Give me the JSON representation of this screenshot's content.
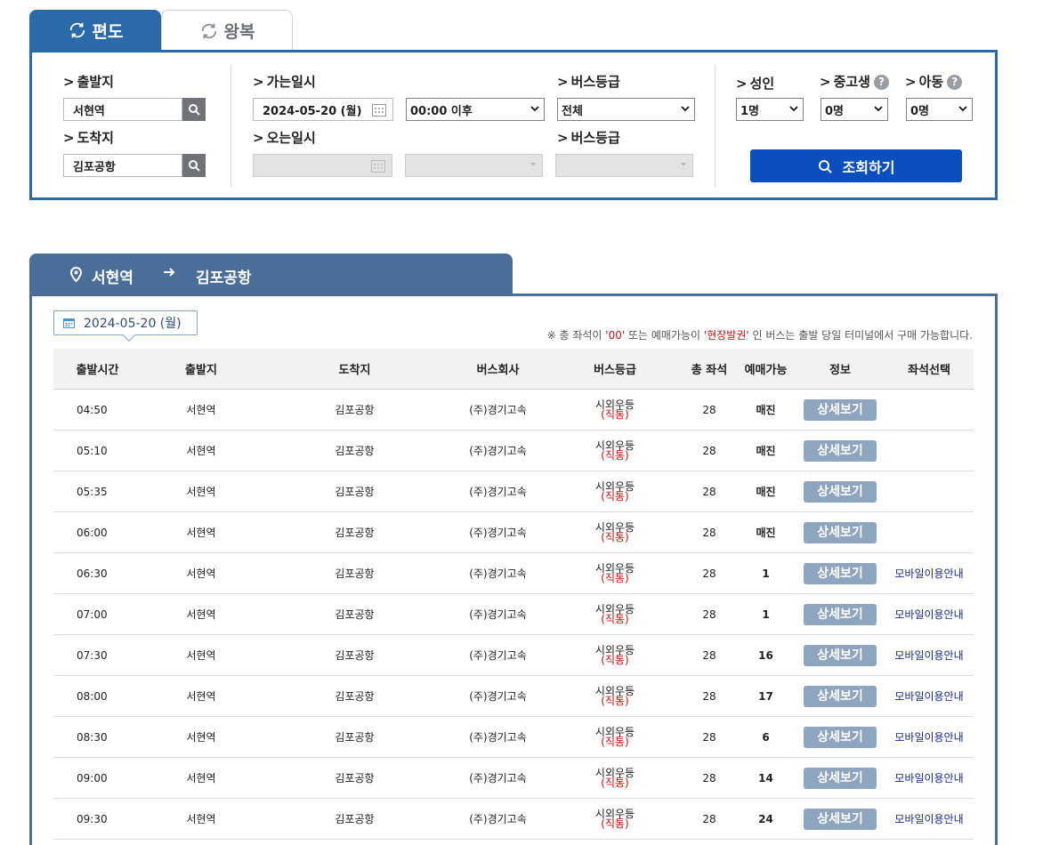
{
  "tabs": {
    "oneway": "편도",
    "roundtrip": "왕복"
  },
  "search": {
    "departure_label": "출발지",
    "departure_value": "서현역",
    "arrival_label": "도착지",
    "arrival_value": "김포공항",
    "go_date_label": "가는일시",
    "go_date_value": "2024-05-20 (월)",
    "go_time_value": "00:00 이후",
    "bus_grade_label": "버스등급",
    "bus_grade_value": "전체",
    "return_date_label": "오는일시",
    "return_grade_label": "버스등급",
    "adult_label": "성인",
    "adult_value": "1명",
    "student_label": "중고생",
    "student_value": "0명",
    "child_label": "아동",
    "child_value": "0명",
    "submit_label": "조회하기"
  },
  "route": {
    "from": "서현역",
    "to": "김포공항"
  },
  "result": {
    "date": "2024-05-20 (월)",
    "notice": {
      "part1": "※ 총 좌석이 ",
      "red1": "'00'",
      "part2": " 또는 예매가능이 ",
      "red2": "'현장발권'",
      "part3": " 인 버스는 출발 당일 터미널에서 구매 가능합니다."
    },
    "headers": [
      "출발시간",
      "출발지",
      "도착지",
      "버스회사",
      "버스등급",
      "총 좌석",
      "예매가능",
      "정보",
      "좌석선택"
    ],
    "rows": [
      {
        "time": "04:50",
        "from": "서현역",
        "to": "김포공항",
        "company": "(주)경기고속",
        "grade": "시외우등",
        "grade_sub": "(직통)",
        "seats": "28",
        "avail": "매진",
        "detail": "상세보기",
        "select": ""
      },
      {
        "time": "05:10",
        "from": "서현역",
        "to": "김포공항",
        "company": "(주)경기고속",
        "grade": "시외우등",
        "grade_sub": "(직통)",
        "seats": "28",
        "avail": "매진",
        "detail": "상세보기",
        "select": ""
      },
      {
        "time": "05:35",
        "from": "서현역",
        "to": "김포공항",
        "company": "(주)경기고속",
        "grade": "시외우등",
        "grade_sub": "(직통)",
        "seats": "28",
        "avail": "매진",
        "detail": "상세보기",
        "select": ""
      },
      {
        "time": "06:00",
        "from": "서현역",
        "to": "김포공항",
        "company": "(주)경기고속",
        "grade": "시외우등",
        "grade_sub": "(직통)",
        "seats": "28",
        "avail": "매진",
        "detail": "상세보기",
        "select": ""
      },
      {
        "time": "06:30",
        "from": "서현역",
        "to": "김포공항",
        "company": "(주)경기고속",
        "grade": "시외우등",
        "grade_sub": "(직통)",
        "seats": "28",
        "avail": "1",
        "detail": "상세보기",
        "select": "모바일이용안내"
      },
      {
        "time": "07:00",
        "from": "서현역",
        "to": "김포공항",
        "company": "(주)경기고속",
        "grade": "시외우등",
        "grade_sub": "(직통)",
        "seats": "28",
        "avail": "1",
        "detail": "상세보기",
        "select": "모바일이용안내"
      },
      {
        "time": "07:30",
        "from": "서현역",
        "to": "김포공항",
        "company": "(주)경기고속",
        "grade": "시외우등",
        "grade_sub": "(직통)",
        "seats": "28",
        "avail": "16",
        "detail": "상세보기",
        "select": "모바일이용안내"
      },
      {
        "time": "08:00",
        "from": "서현역",
        "to": "김포공항",
        "company": "(주)경기고속",
        "grade": "시외우등",
        "grade_sub": "(직통)",
        "seats": "28",
        "avail": "17",
        "detail": "상세보기",
        "select": "모바일이용안내"
      },
      {
        "time": "08:30",
        "from": "서현역",
        "to": "김포공항",
        "company": "(주)경기고속",
        "grade": "시외우등",
        "grade_sub": "(직통)",
        "seats": "28",
        "avail": "6",
        "detail": "상세보기",
        "select": "모바일이용안내"
      },
      {
        "time": "09:00",
        "from": "서현역",
        "to": "김포공항",
        "company": "(주)경기고속",
        "grade": "시외우등",
        "grade_sub": "(직통)",
        "seats": "28",
        "avail": "14",
        "detail": "상세보기",
        "select": "모바일이용안내"
      },
      {
        "time": "09:30",
        "from": "서현역",
        "to": "김포공항",
        "company": "(주)경기고속",
        "grade": "시외우등",
        "grade_sub": "(직통)",
        "seats": "28",
        "avail": "24",
        "detail": "상세보기",
        "select": "모바일이용안내"
      }
    ]
  },
  "icons": {
    "tab_oneway": "refresh-icon",
    "tab_roundtrip": "refresh-icon",
    "search_buttons": "search-icon",
    "calendar": "calendar-icon",
    "route_pin": "location-pin-icon",
    "route_arrow": "arrow-right-icon",
    "help": "question-icon"
  },
  "colors": {
    "primary": "#2b6aa9",
    "route_header": "#4a6e97",
    "submit": "#0b4fbf",
    "detail_button": "#8ea5bf",
    "notice_red": "#cc1111",
    "link": "#1a2a8a"
  }
}
